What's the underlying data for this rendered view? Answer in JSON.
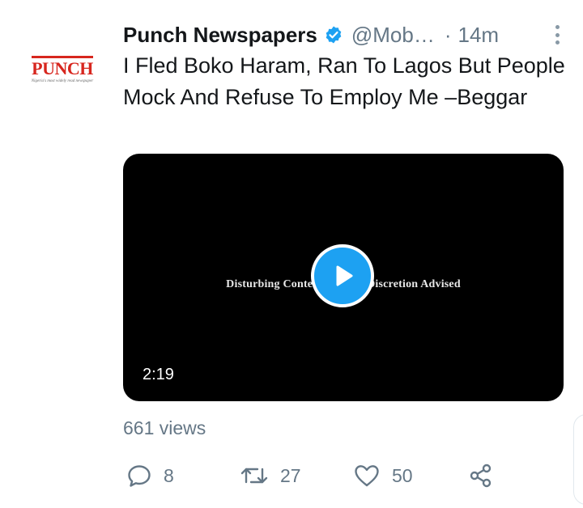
{
  "tweet": {
    "author_name": "Punch Newspapers",
    "handle": "@Mob…",
    "separator": "·",
    "time": "14m",
    "avatar": {
      "logo_text": "PUNCH",
      "tagline": "Nigeria's most widely read newspaper"
    },
    "text": "I Fled Boko Haram, Ran To Lagos But People Mock And Refuse To Employ Me –Beggar",
    "media": {
      "warning_text": "Disturbing Content. Viewer Discretion Advised",
      "duration": "2:19"
    },
    "views": "661 views",
    "actions": {
      "reply_count": "8",
      "retweet_count": "27",
      "like_count": "50"
    }
  },
  "colors": {
    "accent": "#1da1f2",
    "secondary_text": "#657786",
    "logo_red": "#d7261e"
  },
  "icons": [
    "verified-badge-icon",
    "more-icon",
    "play-icon",
    "reply-icon",
    "retweet-icon",
    "like-icon",
    "share-icon"
  ]
}
